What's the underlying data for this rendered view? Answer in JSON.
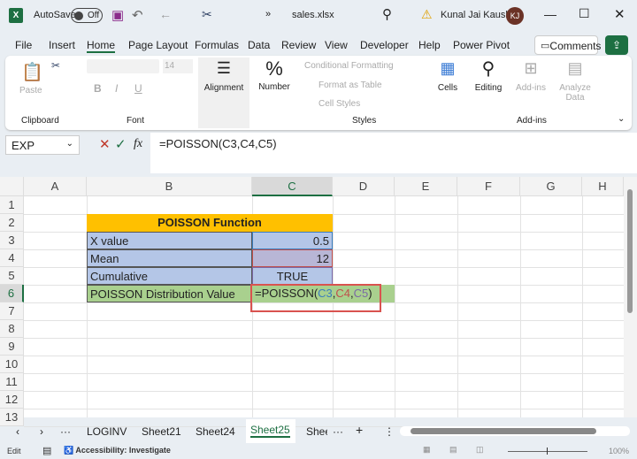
{
  "titlebar": {
    "autosave_label": "AutoSave",
    "autosave_state": "Off",
    "filename": "sales.xlsx",
    "user_name": "Kunal Jai Kaushik",
    "user_initials": "KJ"
  },
  "menu": [
    "File",
    "Insert",
    "Home",
    "Page Layout",
    "Formulas",
    "Data",
    "Review",
    "View",
    "Developer",
    "Help",
    "Power Pivot"
  ],
  "menu_active": "Home",
  "comments_label": "Comments",
  "ribbon": {
    "paste": "Paste",
    "clipboard": "Clipboard",
    "font_size": "14",
    "font": "Font",
    "alignment": "Alignment",
    "number": "Number",
    "conditional_formatting": "Conditional Formatting",
    "format_as_table": "Format as Table",
    "cell_styles": "Cell Styles",
    "styles": "Styles",
    "cells": "Cells",
    "editing": "Editing",
    "addins": "Add-ins",
    "addins_group": "Add-ins",
    "analyze_data": "Analyze Data"
  },
  "formula_bar": {
    "name_box": "EXP",
    "fx": "fx",
    "formula": "=POISSON(C3,C4,C5)"
  },
  "columns": [
    "A",
    "B",
    "C",
    "D",
    "E",
    "F",
    "G",
    "H"
  ],
  "rows": [
    "1",
    "2",
    "3",
    "4",
    "5",
    "6",
    "7",
    "8",
    "9",
    "10",
    "11",
    "12",
    "13"
  ],
  "cells": {
    "b2": "POISSON Function",
    "b3": "X value",
    "c3": "0.5",
    "b4": "Mean",
    "c4": "12",
    "b5": "Cumulative",
    "c5": "TRUE",
    "b6": "POISSON Distribution Value",
    "c6_prefix": "=POISSON(",
    "c6_ref1": "C3",
    "c6_ref2": "C4",
    "c6_ref3": "C5",
    "c6_suffix": ")",
    "comma": ","
  },
  "colors": {
    "header_fill": "#ffc000",
    "input_fill": "#b4c6e7",
    "result_fill": "#a9d08e",
    "excel_green": "#1d6f42",
    "ref1": "#3b7dbd",
    "ref2": "#c0504d",
    "ref3": "#7b68a6"
  },
  "sheet_tabs": [
    "LOGINV",
    "Sheet21",
    "Sheet24",
    "Sheet25",
    "Shee"
  ],
  "active_sheet": "Sheet25",
  "status": {
    "mode": "Edit",
    "accessibility": "Accessibility: Investigate",
    "zoom": "100%"
  }
}
